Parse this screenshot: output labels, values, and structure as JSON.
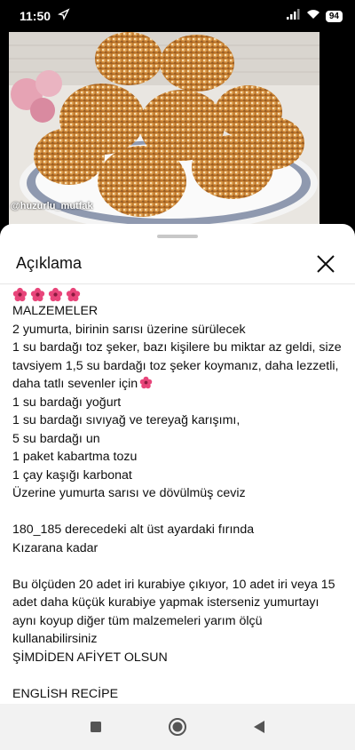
{
  "status_bar": {
    "time": "11:50",
    "battery": "94"
  },
  "video": {
    "watermark": "@huzurlu_mutfak"
  },
  "sheet": {
    "title": "Açıklama",
    "description_lines": [
      "MALZEMELER",
      "2 yumurta, birinin sarısı üzerine sürülecek",
      "1 su bardağı toz şeker, bazı kişilere bu miktar az geldi, size tavsiyem 1,5 su bardağı toz şeker koymanız, daha lezzetli, daha tatlı sevenler için",
      "1 su bardağı yoğurt",
      "1 su bardağı sıvıyağ ve tereyağ karışımı,",
      "5 su bardağı un",
      "1 paket kabartma tozu",
      "1 çay kaşığı karbonat",
      "Üzerine yumurta sarısı ve dövülmüş ceviz",
      "",
      "180_185 derecedeki alt üst ayardaki fırında",
      "Kızarana kadar",
      "",
      "Bu ölçüden 20 adet iri kurabiye çıkıyor, 10 adet iri veya 15 adet daha küçük kurabiye yapmak isterseniz yumurtayı aynı koyup diğer tüm malzemeleri yarım ölçü kullanabilirsiniz",
      "ŞİMDİDEN AFİYET OLSUN",
      "",
      "ENGLİSH RECİPE"
    ]
  },
  "colors": {
    "flower": "#e8457a",
    "pastry": "#d08a3a",
    "background": "#ffffff"
  }
}
